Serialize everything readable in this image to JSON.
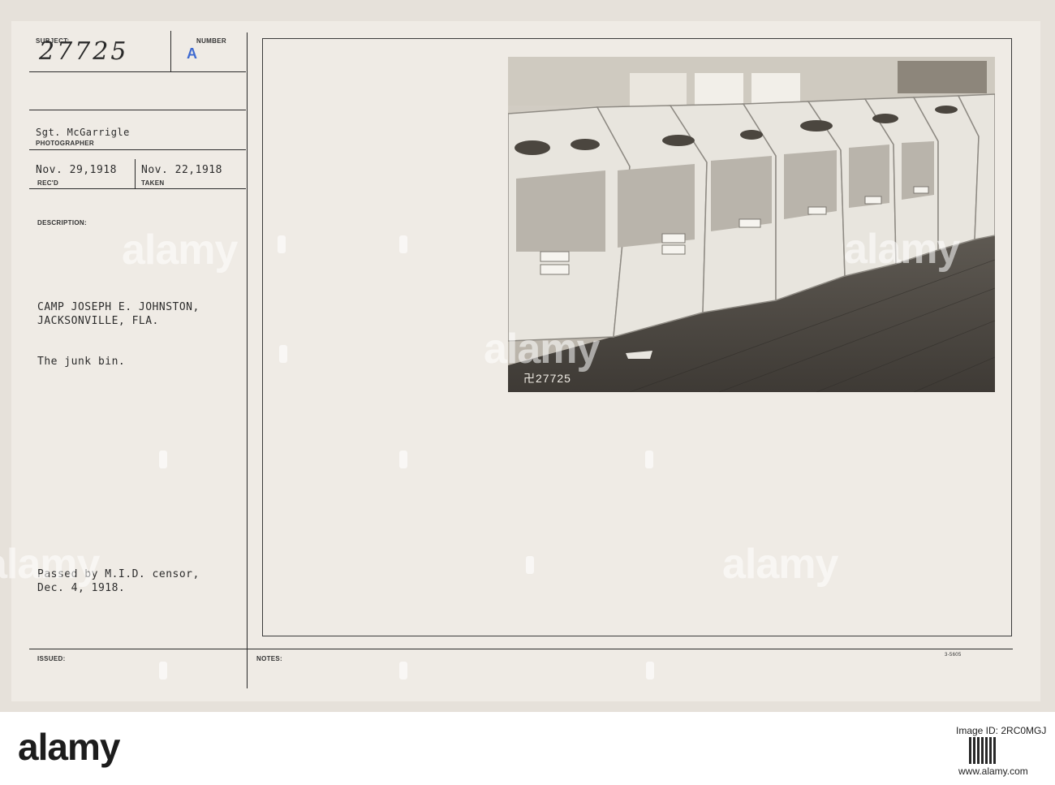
{
  "form": {
    "subject_label": "SUBJECT:",
    "subject_number": "27725",
    "number_label": "NUMBER",
    "number_value": "A",
    "photographer_name": "Sgt. McGarrigle",
    "photographer_label": "PHOTOGRAPHER",
    "received_date": "Nov. 29,1918",
    "received_label": "REC'D",
    "taken_date": "Nov. 22,1918",
    "taken_label": "TAKEN",
    "description_label": "DESCRIPTION:",
    "description_line1": "CAMP JOSEPH E. JOHNSTON,",
    "description_line2": "JACKSONVILLE, FLA.",
    "description_line3": "The junk bin.",
    "censor_line1": "Passed by M.I.D. censor,",
    "censor_line2": "Dec. 4, 1918.",
    "issued_label": "ISSUED:",
    "notes_label": "NOTES:",
    "form_code": "3-5605"
  },
  "photo": {
    "caption": "卍27725",
    "subject": "wooden junk bins in warehouse"
  },
  "watermark": {
    "text": "alamy"
  },
  "footer": {
    "brand": "alamy",
    "image_id": "Image ID: 2RC0MGJ",
    "url": "www.alamy.com"
  }
}
